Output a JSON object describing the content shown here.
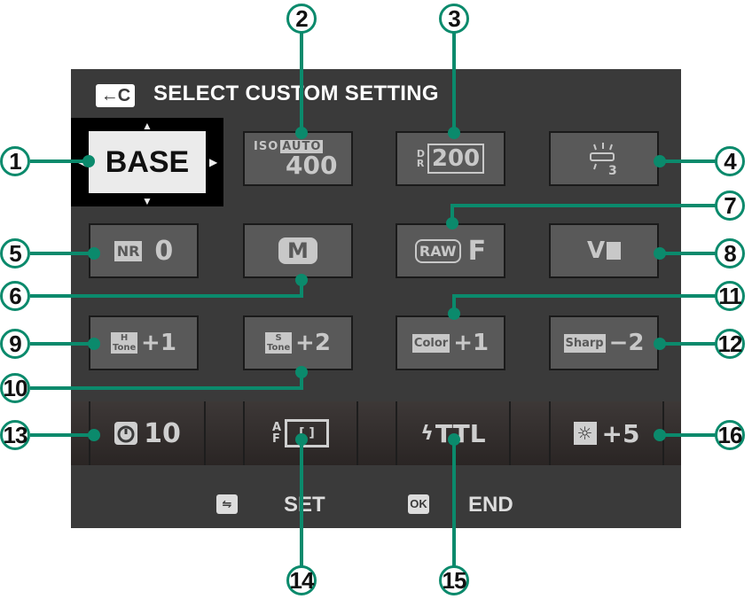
{
  "title": "SELECT CUSTOM SETTING",
  "title_icon": "←C",
  "settings": {
    "base": "BASE",
    "iso": {
      "label": "ISO",
      "mode": "AUTO",
      "value": "400"
    },
    "dr": {
      "label": "DR",
      "value": "200"
    },
    "wb_icon": "3",
    "nr": {
      "label": "NR",
      "value": "0"
    },
    "film_icon": "M",
    "raw": {
      "label": "RAW",
      "value": "F"
    },
    "film_sim_icon": "V",
    "htone": {
      "label": "H Tone",
      "value": "+1"
    },
    "stone": {
      "label": "S Tone",
      "value": "+2"
    },
    "color": {
      "label": "Color",
      "value": "+1"
    },
    "sharp": {
      "label": "Sharp",
      "value": "−2"
    }
  },
  "bottom": {
    "self_timer": "10",
    "af_label": "AF",
    "flash": "TTL",
    "brightness": "+5"
  },
  "footer": {
    "set_label": "SET",
    "end_label": "END",
    "ok_label": "OK"
  },
  "callouts": [
    "1",
    "2",
    "3",
    "4",
    "5",
    "6",
    "7",
    "8",
    "9",
    "10",
    "11",
    "12",
    "13",
    "14",
    "15",
    "16"
  ],
  "colors": {
    "accent": "#0b8a6c",
    "screen_bg": "#3a3a3a",
    "tile_bg": "#595959",
    "selected_bg": "#ebebeb"
  }
}
